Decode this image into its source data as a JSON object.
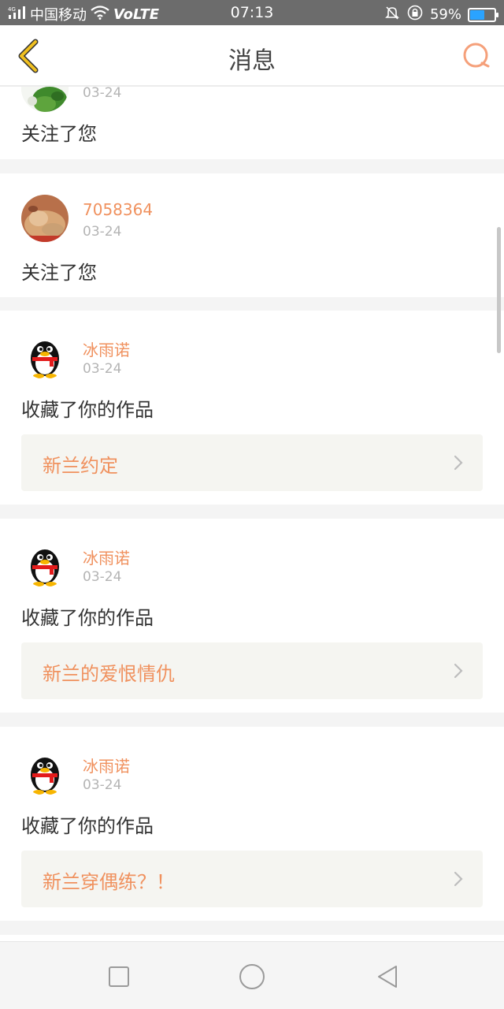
{
  "statusbar": {
    "carrier": "中国移动",
    "volte": "VoLTE",
    "time": "07:13",
    "battery": "59%",
    "battery_level": 0.59,
    "accent": "#2aa3ff"
  },
  "header": {
    "title": "消息",
    "accent": "#f0a02b",
    "search_color": "#f5a07a"
  },
  "messages": [
    {
      "user": "",
      "date": "03-24",
      "action": "关注了您"
    },
    {
      "user": "7058364",
      "date": "03-24",
      "action": "关注了您"
    },
    {
      "user": "冰雨诺",
      "date": "03-24",
      "action": "收藏了你的作品",
      "work": "新兰约定"
    },
    {
      "user": "冰雨诺",
      "date": "03-24",
      "action": "收藏了你的作品",
      "work": "新兰的爱恨情仇"
    },
    {
      "user": "冰雨诺",
      "date": "03-24",
      "action": "收藏了你的作品",
      "work": "新兰穿偶练？！"
    }
  ],
  "colors": {
    "username": "#f0915e",
    "date": "#b4b4b4",
    "work_bg": "#f5f5f1"
  }
}
